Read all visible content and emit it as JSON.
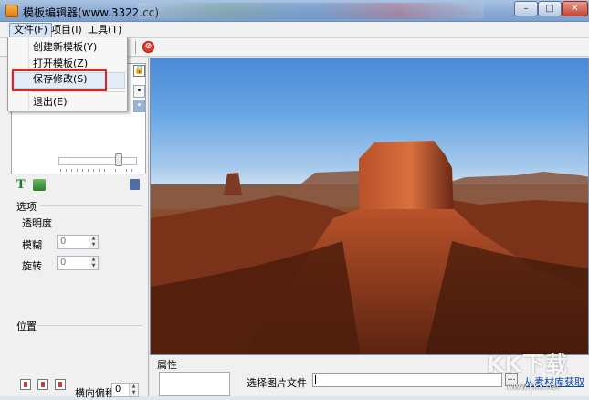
{
  "window": {
    "title": "模板编辑器(www.3322.cc)",
    "controls": {
      "minimize": "–",
      "maximize": "□",
      "close": "✕"
    }
  },
  "menubar": {
    "file": "文件(F)",
    "project": "项目(I)",
    "tools": "工具(T)"
  },
  "file_menu": {
    "items": [
      "创建新模板(Y)",
      "打开模板(Z)",
      "保存修改(S)",
      "退出(E)"
    ],
    "highlighted_index": 2
  },
  "left_panel": {
    "options_title": "选项",
    "opacity_label": "透明度",
    "blur_label": "模糊",
    "blur_value": "0",
    "rotate_label": "旋转",
    "rotate_value": "0",
    "position_title": "位置",
    "horizontal_offset_label": "横向偏移",
    "horizontal_offset_value": "0"
  },
  "properties": {
    "title": "属性",
    "select_image_label": "选择图片文件",
    "file_value": "",
    "browse_label": "…",
    "library_link": "从素材库获取"
  },
  "watermark": {
    "brand": "KK下载",
    "url": "www.kkx.net"
  },
  "colors": {
    "annotation": "#e52222",
    "link": "#0645ad",
    "title_bar": "#88a8d2"
  },
  "icons": [
    "app-icon",
    "stop-icon",
    "lock-icon",
    "text-add-icon",
    "image-add-icon",
    "trash-icon",
    "align-left-icon",
    "align-center-icon",
    "align-right-icon"
  ]
}
